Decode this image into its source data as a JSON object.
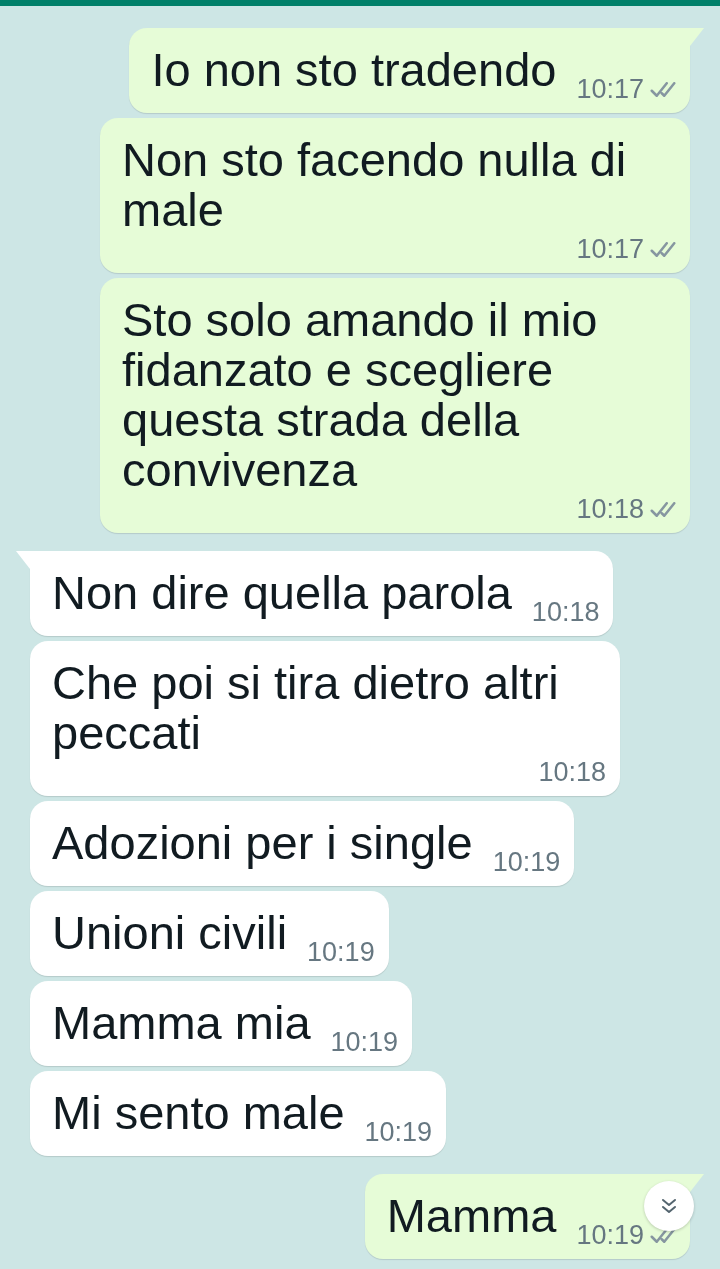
{
  "messages": [
    {
      "kind": "outgoing",
      "text": "Io non sto tradendo",
      "time": "10:17",
      "tail": true
    },
    {
      "kind": "outgoing",
      "text": "Non sto facendo nulla di male",
      "time": "10:17",
      "tail": false
    },
    {
      "kind": "outgoing",
      "text": "Sto solo amando il mio fidanzato e scegliere questa strada della convivenza",
      "time": "10:18",
      "tail": false
    },
    {
      "kind": "incoming",
      "text": "Non dire quella parola",
      "time": "10:18",
      "tail": true
    },
    {
      "kind": "incoming",
      "text": "Che poi si tira dietro altri peccati",
      "time": "10:18",
      "tail": false
    },
    {
      "kind": "incoming",
      "text": "Adozioni per i single",
      "time": "10:19",
      "tail": false
    },
    {
      "kind": "incoming",
      "text": "Unioni civili",
      "time": "10:19",
      "tail": false
    },
    {
      "kind": "incoming",
      "text": "Mamma mia",
      "time": "10:19",
      "tail": false
    },
    {
      "kind": "incoming",
      "text": "Mi sento male",
      "time": "10:19",
      "tail": false
    },
    {
      "kind": "outgoing",
      "text": "Mamma",
      "time": "10:19",
      "tail": true
    }
  ]
}
